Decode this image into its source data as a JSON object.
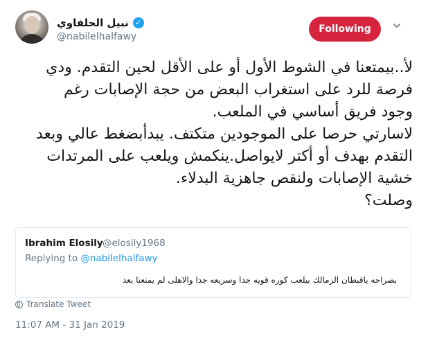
{
  "author": {
    "display_name": "نبيل الحلفاوي",
    "handle": "@nabilelhalfawy",
    "verified_glyph": "✓"
  },
  "follow_button": {
    "label": "Following",
    "color": "#d6243f"
  },
  "menu": {
    "icon": "chevron-down-icon"
  },
  "tweet": {
    "lines": [
      "لأ..بيمتعنا في الشوط الأول أو على الأقل لحين التقدم. ودي",
      "فرصة للرد على استغراب البعض من حجة الإصابات رغم",
      "وجود فريق أساسي في الملعب.",
      "لاسارتي حرصا على الموجودين متكتف. يبدأبضغط عالي وبعد",
      "التقدم بهدف أو أكتر لايواصل.ينكمش ويلعب على المرتدات",
      "خشية الإصابات ولنقص جاهزية البدلاء.",
      "وصلت؟"
    ]
  },
  "quoted_tweet": {
    "name": "Ibrahim Elosily",
    "handle": "@elosily1968",
    "replying_prefix": "Replying to ",
    "replying_to": "@nabilelhalfawy",
    "text": "بصراحه  ياقبطان  الزمالك بيلعب كوره قويه جدا  وسريعه جدا  والاهلى لم يمتعنا بعد"
  },
  "translate": {
    "label": "Translate Tweet",
    "icon": "globe-icon"
  },
  "timestamp": "11:07 AM - 31 Jan 2019",
  "colors": {
    "link": "#1b95e0",
    "muted": "#657786",
    "verified": "#1da1f2"
  }
}
